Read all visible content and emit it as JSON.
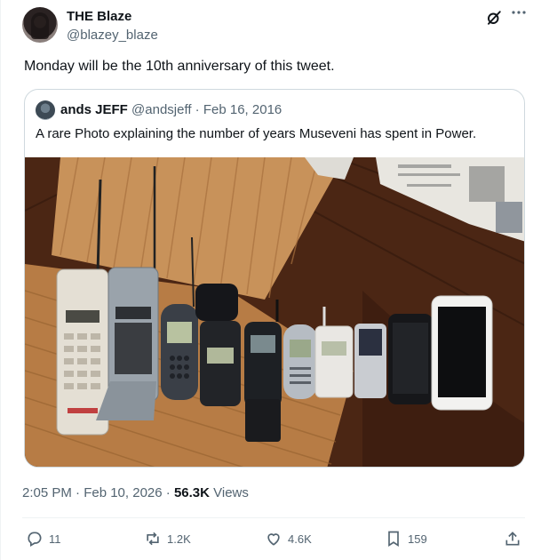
{
  "author": {
    "display_name": "THE Blaze",
    "handle": "@blazey_blaze",
    "avatar_icon": "profile-avatar"
  },
  "tweet": {
    "text": "Monday will be the 10th anniversary of this tweet.",
    "timestamp": "2:05 PM · Feb 10, 2026 · ",
    "views_count": "56.3K",
    "views_label": " Views"
  },
  "quoted": {
    "display_name": "ands JEFF",
    "meta": " @andsjeff · Feb 16, 2016",
    "text": "A rare Photo explaining the number of years Museveni has spent in Power.",
    "photo_description": "photo-of-mobile-phones-on-wooden-table"
  },
  "actions": {
    "replies": "11",
    "reposts": "1.2K",
    "likes": "4.6K",
    "bookmarks": "159"
  },
  "colors": {
    "text_primary": "#0f1419",
    "text_secondary": "#536471",
    "border": "#cfd9de"
  }
}
